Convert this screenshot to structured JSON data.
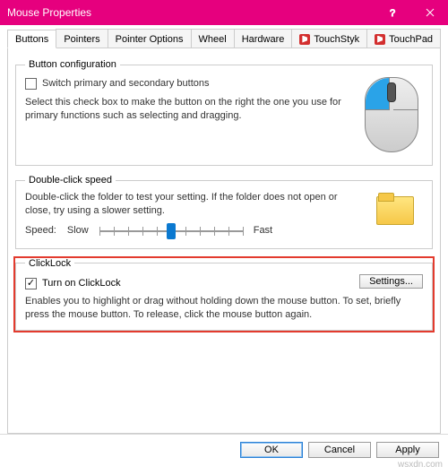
{
  "window": {
    "title": "Mouse Properties"
  },
  "tabs": [
    "Buttons",
    "Pointers",
    "Pointer Options",
    "Wheel",
    "Hardware",
    "TouchStyk",
    "TouchPad"
  ],
  "active_tab": 0,
  "buttoncfg": {
    "legend": "Button configuration",
    "checkbox_label": "Switch primary and secondary buttons",
    "checked": false,
    "desc": "Select this check box to make the button on the right the one you use for primary functions such as selecting and dragging."
  },
  "dblclick": {
    "legend": "Double-click speed",
    "desc": "Double-click the folder to test your setting. If the folder does not open or close, try using a slower setting.",
    "speed_label": "Speed:",
    "slow": "Slow",
    "fast": "Fast",
    "value_percent": 50
  },
  "clicklock": {
    "legend": "ClickLock",
    "checkbox_label": "Turn on ClickLock",
    "checked": true,
    "settings_btn": "Settings...",
    "desc": "Enables you to highlight or drag without holding down the mouse button. To set, briefly press the mouse button. To release, click the mouse button again."
  },
  "footer": {
    "ok": "OK",
    "cancel": "Cancel",
    "apply": "Apply"
  },
  "watermark": "wsxdn.com"
}
